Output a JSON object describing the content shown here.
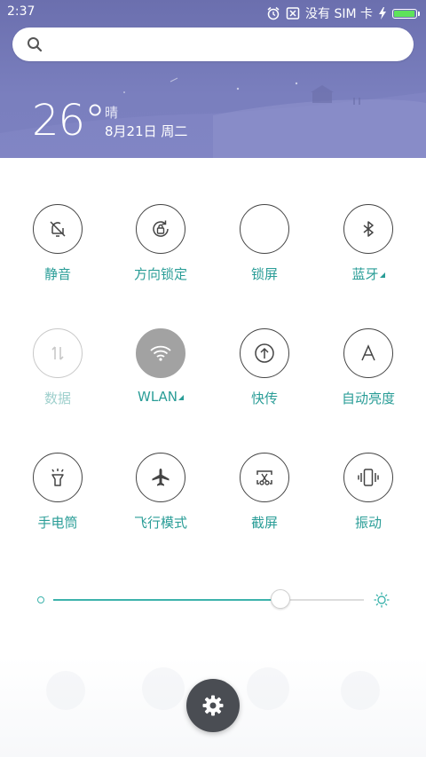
{
  "status_bar": {
    "time": "2:37",
    "carrier": "没有 SIM 卡",
    "battery_level": 0.95
  },
  "search": {
    "placeholder": ""
  },
  "weather": {
    "temperature": "26°",
    "condition": "晴",
    "date": "8月21日 周二"
  },
  "toggles": [
    {
      "label": "静音",
      "icon": "bell-off-icon",
      "state": "off"
    },
    {
      "label": "方向锁定",
      "icon": "rotation-lock-icon",
      "state": "off"
    },
    {
      "label": "锁屏",
      "icon": "lock-screen-icon",
      "state": "off"
    },
    {
      "label": "蓝牙",
      "icon": "bluetooth-icon",
      "state": "off"
    },
    {
      "label": "数据",
      "icon": "mobile-data-icon",
      "state": "disabled"
    },
    {
      "label": "WLAN",
      "icon": "wifi-icon",
      "state": "on"
    },
    {
      "label": "快传",
      "icon": "quick-transfer-icon",
      "state": "off"
    },
    {
      "label": "自动亮度",
      "icon": "auto-brightness-icon",
      "state": "off"
    },
    {
      "label": "手电筒",
      "icon": "flashlight-icon",
      "state": "off"
    },
    {
      "label": "飞行模式",
      "icon": "airplane-icon",
      "state": "off"
    },
    {
      "label": "截屏",
      "icon": "screenshot-icon",
      "state": "off"
    },
    {
      "label": "振动",
      "icon": "vibrate-icon",
      "state": "off"
    }
  ],
  "brightness": {
    "level": 0.73
  },
  "colors": {
    "accent": "#2a9d97",
    "header_bg": "#7478b8",
    "active_toggle": "#a2a2a2",
    "settings_button": "#4a4d53"
  }
}
